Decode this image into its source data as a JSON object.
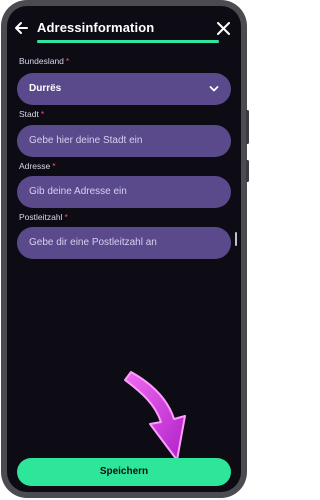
{
  "header": {
    "title": "Adressinformation",
    "back_icon": "arrow-left-icon",
    "close_icon": "close-icon",
    "progress": 1.0,
    "accent_color": "#2ee6a0"
  },
  "form": {
    "state": {
      "label": "Bundesland",
      "required_mark": "*",
      "value": "Durrës",
      "icon": "chevron-down-icon"
    },
    "city": {
      "label": "Stadt",
      "required_mark": "*",
      "placeholder": "Gebe hier deine Stadt ein"
    },
    "address": {
      "label": "Adresse",
      "required_mark": "*",
      "placeholder": "Gib deine Adresse ein"
    },
    "postal_code": {
      "label": "Postleitzahl",
      "required_mark": "*",
      "placeholder": "Gebe dir eine Postleitzahl an"
    }
  },
  "footer": {
    "save_label": "Speichern",
    "button_color": "#2ee69a"
  },
  "overlay": {
    "icon": "curved-arrow-icon",
    "color": "#e040e6"
  }
}
